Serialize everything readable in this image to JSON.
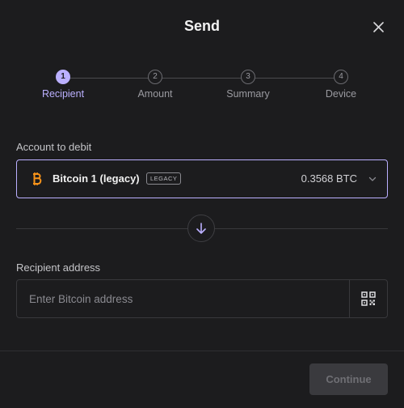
{
  "modal": {
    "title": "Send"
  },
  "steps": [
    {
      "number": "1",
      "label": "Recipient",
      "active": true
    },
    {
      "number": "2",
      "label": "Amount",
      "active": false
    },
    {
      "number": "3",
      "label": "Summary",
      "active": false
    },
    {
      "number": "4",
      "label": "Device",
      "active": false
    }
  ],
  "account": {
    "label": "Account to debit",
    "name": "Bitcoin 1 (legacy)",
    "tag": "LEGACY",
    "balance": "0.3568 BTC",
    "icon": "bitcoin-icon"
  },
  "recipient": {
    "label": "Recipient address",
    "placeholder": "Enter Bitcoin address",
    "value": ""
  },
  "footer": {
    "continue_label": "Continue",
    "continue_disabled": true
  },
  "colors": {
    "accent": "#bbb0ff",
    "bitcoin": "#f7931a",
    "background": "#1c1c1e"
  }
}
